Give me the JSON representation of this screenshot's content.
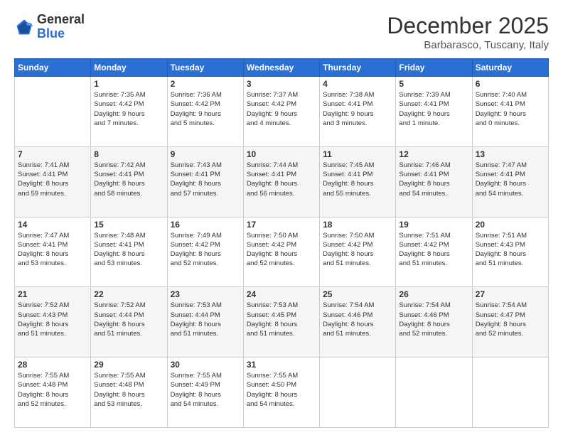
{
  "header": {
    "logo_general": "General",
    "logo_blue": "Blue",
    "month_title": "December 2025",
    "location": "Barbarasco, Tuscany, Italy"
  },
  "weekdays": [
    "Sunday",
    "Monday",
    "Tuesday",
    "Wednesday",
    "Thursday",
    "Friday",
    "Saturday"
  ],
  "weeks": [
    [
      {
        "day": "",
        "info": ""
      },
      {
        "day": "1",
        "info": "Sunrise: 7:35 AM\nSunset: 4:42 PM\nDaylight: 9 hours\nand 7 minutes."
      },
      {
        "day": "2",
        "info": "Sunrise: 7:36 AM\nSunset: 4:42 PM\nDaylight: 9 hours\nand 5 minutes."
      },
      {
        "day": "3",
        "info": "Sunrise: 7:37 AM\nSunset: 4:42 PM\nDaylight: 9 hours\nand 4 minutes."
      },
      {
        "day": "4",
        "info": "Sunrise: 7:38 AM\nSunset: 4:41 PM\nDaylight: 9 hours\nand 3 minutes."
      },
      {
        "day": "5",
        "info": "Sunrise: 7:39 AM\nSunset: 4:41 PM\nDaylight: 9 hours\nand 1 minute."
      },
      {
        "day": "6",
        "info": "Sunrise: 7:40 AM\nSunset: 4:41 PM\nDaylight: 9 hours\nand 0 minutes."
      }
    ],
    [
      {
        "day": "7",
        "info": "Sunrise: 7:41 AM\nSunset: 4:41 PM\nDaylight: 8 hours\nand 59 minutes."
      },
      {
        "day": "8",
        "info": "Sunrise: 7:42 AM\nSunset: 4:41 PM\nDaylight: 8 hours\nand 58 minutes."
      },
      {
        "day": "9",
        "info": "Sunrise: 7:43 AM\nSunset: 4:41 PM\nDaylight: 8 hours\nand 57 minutes."
      },
      {
        "day": "10",
        "info": "Sunrise: 7:44 AM\nSunset: 4:41 PM\nDaylight: 8 hours\nand 56 minutes."
      },
      {
        "day": "11",
        "info": "Sunrise: 7:45 AM\nSunset: 4:41 PM\nDaylight: 8 hours\nand 55 minutes."
      },
      {
        "day": "12",
        "info": "Sunrise: 7:46 AM\nSunset: 4:41 PM\nDaylight: 8 hours\nand 54 minutes."
      },
      {
        "day": "13",
        "info": "Sunrise: 7:47 AM\nSunset: 4:41 PM\nDaylight: 8 hours\nand 54 minutes."
      }
    ],
    [
      {
        "day": "14",
        "info": "Sunrise: 7:47 AM\nSunset: 4:41 PM\nDaylight: 8 hours\nand 53 minutes."
      },
      {
        "day": "15",
        "info": "Sunrise: 7:48 AM\nSunset: 4:41 PM\nDaylight: 8 hours\nand 53 minutes."
      },
      {
        "day": "16",
        "info": "Sunrise: 7:49 AM\nSunset: 4:42 PM\nDaylight: 8 hours\nand 52 minutes."
      },
      {
        "day": "17",
        "info": "Sunrise: 7:50 AM\nSunset: 4:42 PM\nDaylight: 8 hours\nand 52 minutes."
      },
      {
        "day": "18",
        "info": "Sunrise: 7:50 AM\nSunset: 4:42 PM\nDaylight: 8 hours\nand 51 minutes."
      },
      {
        "day": "19",
        "info": "Sunrise: 7:51 AM\nSunset: 4:42 PM\nDaylight: 8 hours\nand 51 minutes."
      },
      {
        "day": "20",
        "info": "Sunrise: 7:51 AM\nSunset: 4:43 PM\nDaylight: 8 hours\nand 51 minutes."
      }
    ],
    [
      {
        "day": "21",
        "info": "Sunrise: 7:52 AM\nSunset: 4:43 PM\nDaylight: 8 hours\nand 51 minutes."
      },
      {
        "day": "22",
        "info": "Sunrise: 7:52 AM\nSunset: 4:44 PM\nDaylight: 8 hours\nand 51 minutes."
      },
      {
        "day": "23",
        "info": "Sunrise: 7:53 AM\nSunset: 4:44 PM\nDaylight: 8 hours\nand 51 minutes."
      },
      {
        "day": "24",
        "info": "Sunrise: 7:53 AM\nSunset: 4:45 PM\nDaylight: 8 hours\nand 51 minutes."
      },
      {
        "day": "25",
        "info": "Sunrise: 7:54 AM\nSunset: 4:46 PM\nDaylight: 8 hours\nand 51 minutes."
      },
      {
        "day": "26",
        "info": "Sunrise: 7:54 AM\nSunset: 4:46 PM\nDaylight: 8 hours\nand 52 minutes."
      },
      {
        "day": "27",
        "info": "Sunrise: 7:54 AM\nSunset: 4:47 PM\nDaylight: 8 hours\nand 52 minutes."
      }
    ],
    [
      {
        "day": "28",
        "info": "Sunrise: 7:55 AM\nSunset: 4:48 PM\nDaylight: 8 hours\nand 52 minutes."
      },
      {
        "day": "29",
        "info": "Sunrise: 7:55 AM\nSunset: 4:48 PM\nDaylight: 8 hours\nand 53 minutes."
      },
      {
        "day": "30",
        "info": "Sunrise: 7:55 AM\nSunset: 4:49 PM\nDaylight: 8 hours\nand 54 minutes."
      },
      {
        "day": "31",
        "info": "Sunrise: 7:55 AM\nSunset: 4:50 PM\nDaylight: 8 hours\nand 54 minutes."
      },
      {
        "day": "",
        "info": ""
      },
      {
        "day": "",
        "info": ""
      },
      {
        "day": "",
        "info": ""
      }
    ]
  ]
}
